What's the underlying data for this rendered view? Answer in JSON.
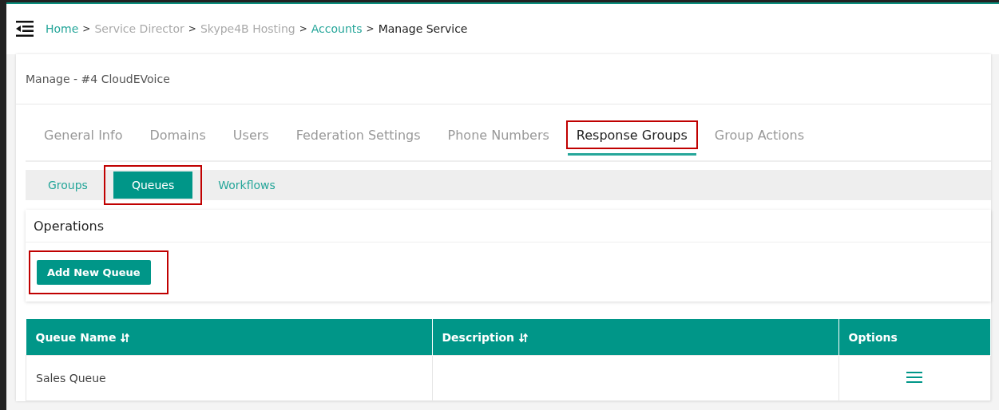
{
  "breadcrumb": [
    {
      "label": "Home",
      "kind": "link"
    },
    {
      "label": "Service Director",
      "kind": "muted"
    },
    {
      "label": "Skype4B Hosting",
      "kind": "muted"
    },
    {
      "label": "Accounts",
      "kind": "link"
    },
    {
      "label": "Manage Service",
      "kind": "current"
    }
  ],
  "separator": ">",
  "card_title": "Manage - #4 CloudEVoice",
  "tabs": [
    {
      "label": "General Info",
      "selected": false,
      "highlighted": false
    },
    {
      "label": "Domains",
      "selected": false,
      "highlighted": false
    },
    {
      "label": "Users",
      "selected": false,
      "highlighted": false
    },
    {
      "label": "Federation Settings",
      "selected": false,
      "highlighted": false
    },
    {
      "label": "Phone Numbers",
      "selected": false,
      "highlighted": false
    },
    {
      "label": "Response Groups",
      "selected": true,
      "highlighted": true
    },
    {
      "label": "Group Actions",
      "selected": false,
      "highlighted": false
    }
  ],
  "subtabs": [
    {
      "label": "Groups",
      "selected": false,
      "highlighted": false
    },
    {
      "label": "Queues",
      "selected": true,
      "highlighted": true
    },
    {
      "label": "Workflows",
      "selected": false,
      "highlighted": false
    }
  ],
  "operations": {
    "title": "Operations",
    "button": {
      "label": "Add New Queue",
      "highlighted": true
    }
  },
  "table": {
    "columns": [
      {
        "label": "Queue Name",
        "sortable": true
      },
      {
        "label": "Description",
        "sortable": true
      },
      {
        "label": "Options",
        "sortable": false
      }
    ],
    "rows": [
      {
        "queue_name": "Sales Queue"
      }
    ]
  }
}
